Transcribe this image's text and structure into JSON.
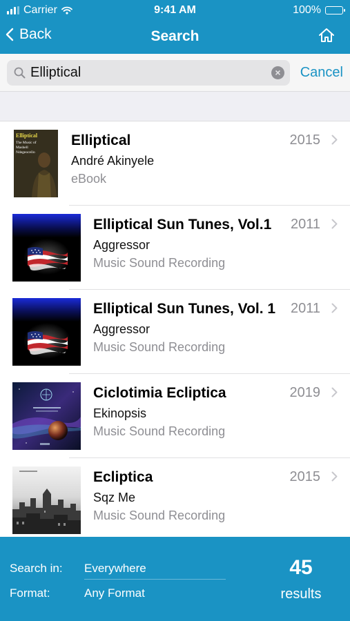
{
  "status_bar": {
    "carrier": "Carrier",
    "time": "9:41 AM",
    "battery": "100%",
    "icons": [
      "signal-icon",
      "wifi-icon",
      "battery-icon"
    ]
  },
  "nav": {
    "back_label": "Back",
    "title": "Search",
    "home_icon": "home-icon"
  },
  "search": {
    "value": "Elliptical",
    "placeholder": "",
    "cancel_label": "Cancel"
  },
  "results": [
    {
      "title": "Elliptical",
      "creator": "André Akinyele",
      "format": "eBook",
      "year": "2015",
      "cover_text": [
        "Elliptical",
        "The Music of",
        "Mashell",
        "Ndegeocello"
      ]
    },
    {
      "title": "Elliptical Sun Tunes, Vol.1",
      "creator": "Aggressor",
      "format": "Music Sound Recording",
      "year": "2011"
    },
    {
      "title": "Elliptical Sun Tunes, Vol. 1",
      "creator": "Aggressor",
      "format": "Music Sound Recording",
      "year": "2011"
    },
    {
      "title": "Ciclotimia Ecliptica",
      "creator": "Ekinopsis",
      "format": "Music Sound Recording",
      "year": "2019"
    },
    {
      "title": "Ecliptica",
      "creator": "Sqz Me",
      "format": "Music Sound Recording",
      "year": "2015"
    }
  ],
  "footer": {
    "search_in_label": "Search in:",
    "search_in_value": "Everywhere",
    "format_label": "Format:",
    "format_value": "Any Format",
    "count": "45",
    "count_label": "results"
  },
  "colors": {
    "accent": "#1a93c4",
    "secondary_text": "#8e8e93"
  }
}
